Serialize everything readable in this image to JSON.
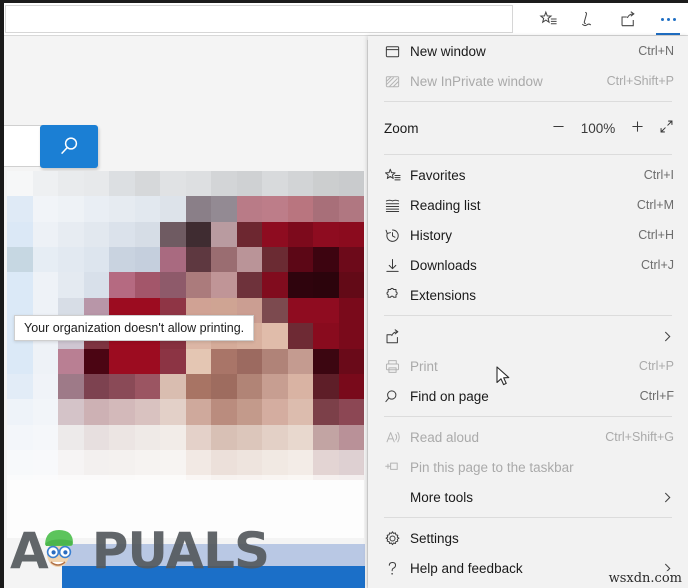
{
  "browser": {
    "address_value": "",
    "address_placeholder": "",
    "toolbar_icons": [
      {
        "name": "favorites-star-icon",
        "label": "Add to favorites or reading list"
      },
      {
        "name": "notes-pen-icon",
        "label": "Make a Web Note"
      },
      {
        "name": "share-icon",
        "label": "Share"
      },
      {
        "name": "more-ellipsis-icon",
        "label": "Settings and more"
      }
    ],
    "accent_color": "#1f6fc4"
  },
  "page": {
    "search_button_icon": "search-icon",
    "search_input_value": "",
    "watermark_logo_text": "PUALS",
    "watermark_logo_lead": "A",
    "button_color": "#1b7fd4",
    "strip_color": "#1b6fc8"
  },
  "menu": {
    "groups": [
      {
        "items": [
          {
            "icon": "new-window-icon",
            "label": "New window",
            "shortcut": "Ctrl+N",
            "disabled": false,
            "chevron": false
          },
          {
            "icon": "inprivate-window-icon",
            "label": "New InPrivate window",
            "shortcut": "Ctrl+Shift+P",
            "disabled": true,
            "chevron": false
          }
        ]
      },
      {
        "zoom": {
          "label": "Zoom",
          "minus": "minus-icon",
          "value": "100%",
          "plus": "plus-icon",
          "fullscreen": "fullscreen-icon"
        }
      },
      {
        "items": [
          {
            "icon": "favorites-star-icon",
            "label": "Favorites",
            "shortcut": "Ctrl+I",
            "disabled": false,
            "chevron": false
          },
          {
            "icon": "reading-list-icon",
            "label": "Reading list",
            "shortcut": "Ctrl+M",
            "disabled": false,
            "chevron": false
          },
          {
            "icon": "history-clock-icon",
            "label": "History",
            "shortcut": "Ctrl+H",
            "disabled": false,
            "chevron": false
          },
          {
            "icon": "downloads-arrow-icon",
            "label": "Downloads",
            "shortcut": "Ctrl+J",
            "disabled": false,
            "chevron": false
          },
          {
            "icon": "extensions-puzzle-icon",
            "label": "Extensions",
            "shortcut": "",
            "disabled": false,
            "chevron": false
          }
        ]
      },
      {
        "items": [
          {
            "icon": "share-icon",
            "label": "",
            "shortcut": "",
            "disabled": false,
            "chevron": true
          },
          {
            "icon": "print-icon",
            "label": "Print",
            "shortcut": "Ctrl+P",
            "disabled": true,
            "chevron": false
          },
          {
            "icon": "find-magnifier-icon",
            "label": "Find on page",
            "shortcut": "Ctrl+F",
            "disabled": false,
            "chevron": false
          }
        ]
      },
      {
        "items": [
          {
            "icon": "read-aloud-icon",
            "label": "Read aloud",
            "shortcut": "Ctrl+Shift+G",
            "disabled": true,
            "chevron": false
          },
          {
            "icon": "pin-taskbar-icon",
            "label": "Pin this page to the taskbar",
            "shortcut": "",
            "disabled": true,
            "chevron": false
          },
          {
            "icon": "",
            "label": "More tools",
            "shortcut": "",
            "disabled": false,
            "chevron": true
          }
        ]
      },
      {
        "items": [
          {
            "icon": "settings-gear-icon",
            "label": "Settings",
            "shortcut": "",
            "disabled": false,
            "chevron": false
          },
          {
            "icon": "help-question-icon",
            "label": "Help and feedback",
            "shortcut": "",
            "disabled": false,
            "chevron": true
          }
        ]
      }
    ],
    "tooltip": "Your organization doesn't allow printing."
  },
  "watermark": {
    "site": "wsxdn.com"
  },
  "mosaic": {
    "cols": 14,
    "rows": 14,
    "colors": [
      "#f6f7f8",
      "#eef0f2",
      "#e9ebed",
      "#e7e9eb",
      "#dcdfe2",
      "#d6d8da",
      "#e0e2e4",
      "#dddfe1",
      "#d3d5d7",
      "#cfd1d3",
      "#d8dadc",
      "#d2d4d6",
      "#cccecf",
      "#c9cbcd",
      "#dfeaf6",
      "#f1f4f8",
      "#eef2f6",
      "#e9eef4",
      "#e6ebf1",
      "#e2e8ef",
      "#dde3ea",
      "#8a7f88",
      "#938a93",
      "#b97b87",
      "#bd7d89",
      "#b9757f",
      "#a86f79",
      "#b07781",
      "#dbe8f6",
      "#edf1f6",
      "#e7ecf2",
      "#e2e8ef",
      "#dbe2eb",
      "#d6dde6",
      "#6f5b62",
      "#3f2c31",
      "#b99ba0",
      "#6d2730",
      "#8e0c20",
      "#7d0a1c",
      "#8e0c20",
      "#8b0b1e",
      "#c6d7e2",
      "#e6edf4",
      "#e2e9f1",
      "#dde5ee",
      "#c9d3e0",
      "#c5cfdd",
      "#a96a80",
      "#5e3840",
      "#9a6d71",
      "#ba9498",
      "#6b2b33",
      "#5c0716",
      "#3d0410",
      "#6d0a1a",
      "#dbe9f7",
      "#eef2f7",
      "#e4eaf1",
      "#d8e0ea",
      "#b56a81",
      "#a3566a",
      "#8e5a6a",
      "#ab7b7c",
      "#c09597",
      "#6e323b",
      "#810c1e",
      "#2f040d",
      "#2c040c",
      "#630a17",
      "#dbe9f7",
      "#eef2f7",
      "#d7dde6",
      "#b896a8",
      "#9c0c20",
      "#9c0c20",
      "#8f3545",
      "#d0a294",
      "#cfa493",
      "#cb9e92",
      "#7c4a4f",
      "#8f0c20",
      "#8f0c20",
      "#7a0a1b",
      "#dbe9f7",
      "#eef2f7",
      "#cfc6d2",
      "#7e3441",
      "#9c0c20",
      "#9c0c20",
      "#87303f",
      "#dcb6a5",
      "#d5ab99",
      "#d8b09e",
      "#e0bcaa",
      "#6e2a34",
      "#890b1e",
      "#7a0a1b",
      "#dbe9f7",
      "#eef2f7",
      "#b97f93",
      "#4b0513",
      "#9c0c20",
      "#9c0c20",
      "#8c3444",
      "#e4c6b3",
      "#a97568",
      "#9c6a60",
      "#b08378",
      "#c49b90",
      "#3c0611",
      "#6a0a19",
      "#e2ecf7",
      "#f0f3f8",
      "#9e7a88",
      "#7d4250",
      "#8a4a57",
      "#9b5562",
      "#d9bdb0",
      "#a87464",
      "#9e6c5f",
      "#b18476",
      "#c79e91",
      "#d9b3a3",
      "#5e1e28",
      "#790a1b",
      "#eef3f9",
      "#f2f5f9",
      "#d4c3c8",
      "#cdb1b4",
      "#d3b9ba",
      "#d9c2c0",
      "#e3d0c8",
      "#cfa99c",
      "#ba8c7e",
      "#c39a8b",
      "#d4ada0",
      "#dcbcae",
      "#7c4049",
      "#8c4754",
      "#f3f6fa",
      "#f5f7fa",
      "#edeaea",
      "#e7dfdf",
      "#ece5e3",
      "#efeae7",
      "#f2ece8",
      "#e4d1c9",
      "#d8c0b5",
      "#dcc6bb",
      "#e3d0c6",
      "#e8d8ce",
      "#c2a4a3",
      "#b99198",
      "#f7f9fb",
      "#f8f9fb",
      "#f6f4f4",
      "#f3f0ef",
      "#f4f1ef",
      "#f6f3f1",
      "#f7f4f2",
      "#f2e9e4",
      "#ece0da",
      "#eee4de",
      "#f1e9e3",
      "#f3ece7",
      "#e3d4d3",
      "#ded0d2",
      "#fafbfc",
      "#fbfbfc",
      "#fbfafa",
      "#fbfafa",
      "#fbfaf9",
      "#fcfbfa",
      "#fcfbfa",
      "#faf6f4",
      "#f7f2ef",
      "#f8f3f0",
      "#f9f5f2",
      "#faf7f4",
      "#f5efee",
      "#f3eeee",
      "#fdfdfd",
      "#fdfdfd",
      "#fdfdfd",
      "#fdfdfd",
      "#fdfdfd",
      "#fdfdfd",
      "#fdfdfd",
      "#fdfcfc",
      "#fcfbfa",
      "#fcfbfa",
      "#fcfbfb",
      "#fcfbfb",
      "#fbfafa",
      "#fbfafa"
    ]
  }
}
